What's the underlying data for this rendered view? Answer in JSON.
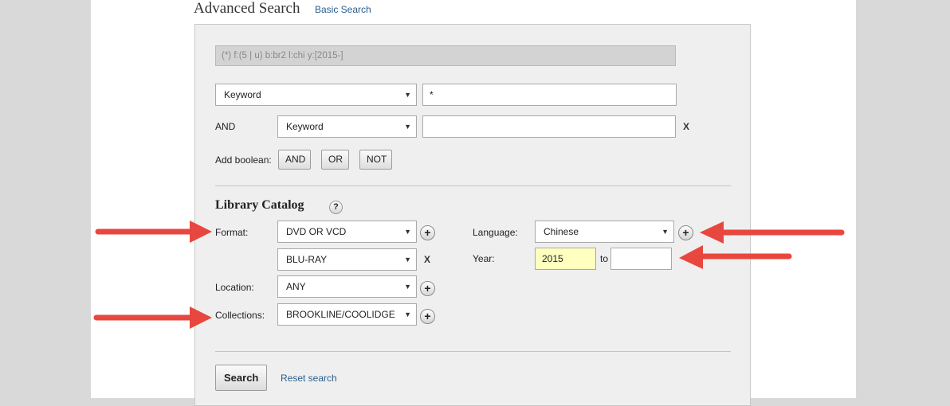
{
  "header": {
    "title": "Advanced Search",
    "basic_link": "Basic Search"
  },
  "query": {
    "expression": "(*) f:(5 | u) b:br2 l:chi y:[2015-]"
  },
  "rows": [
    {
      "conjunction": "",
      "field": "Keyword",
      "value": "*"
    },
    {
      "conjunction": "AND",
      "field": "Keyword",
      "value": "",
      "remove": "X"
    }
  ],
  "boolean": {
    "label": "Add boolean:",
    "buttons": [
      "AND",
      "OR",
      "NOT"
    ]
  },
  "catalog": {
    "heading": "Library Catalog",
    "help": "?",
    "format": {
      "label": "Format:",
      "values": [
        "DVD OR VCD",
        "BLU-RAY"
      ],
      "remove": "X"
    },
    "location": {
      "label": "Location:",
      "value": "ANY"
    },
    "collections": {
      "label": "Collections:",
      "value": "BROOKLINE/COOLIDGE"
    },
    "language": {
      "label": "Language:",
      "value": "Chinese"
    },
    "year": {
      "label": "Year:",
      "from": "2015",
      "to_label": "to",
      "to": ""
    }
  },
  "actions": {
    "search": "Search",
    "reset": "Reset search"
  },
  "icons": {
    "plus": "+",
    "caret": "▼"
  },
  "colors": {
    "arrow": "#e8473f",
    "link": "#2a5d8f",
    "year_highlight": "#ffffc0"
  }
}
